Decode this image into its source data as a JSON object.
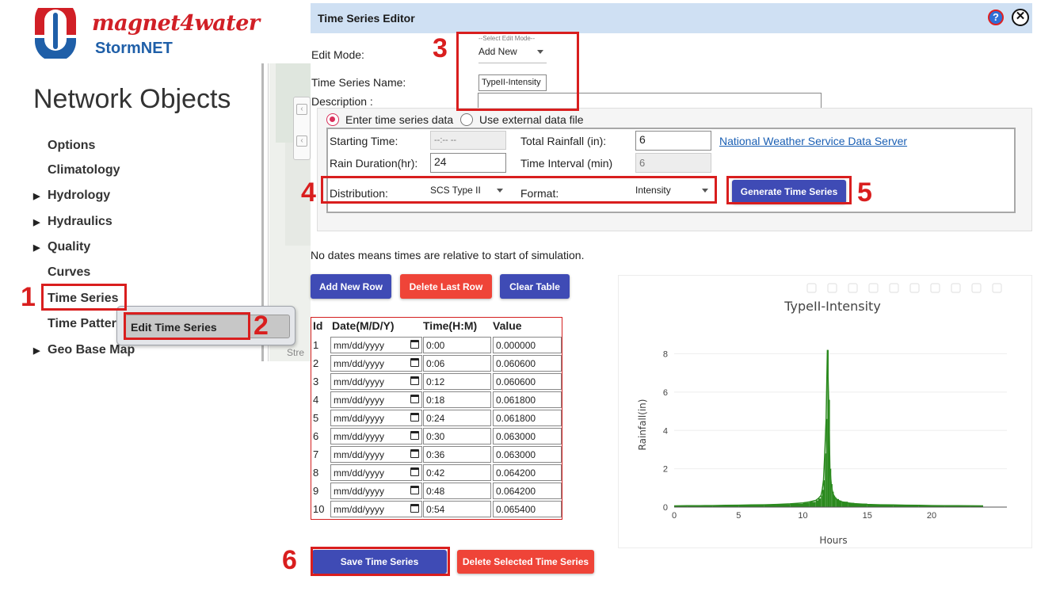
{
  "brand": {
    "name": "magnet4water",
    "product": "StormNET"
  },
  "nav": {
    "title": "Network Objects",
    "items": [
      {
        "label": "Options",
        "expandable": false
      },
      {
        "label": "Climatology",
        "expandable": false
      },
      {
        "label": "Hydrology",
        "expandable": true
      },
      {
        "label": "Hydraulics",
        "expandable": true
      },
      {
        "label": "Quality",
        "expandable": true
      },
      {
        "label": "Curves",
        "expandable": false
      },
      {
        "label": "Time Series",
        "expandable": false
      },
      {
        "label": "Time Patter",
        "expandable": false
      },
      {
        "label": "Geo Base Map",
        "expandable": true
      }
    ],
    "context_menu_item": "Edit Time Series"
  },
  "map": {
    "partial_label": "Stre"
  },
  "editor": {
    "title": "Time Series Editor",
    "help_icon": "help-icon",
    "close_icon": "close-icon",
    "edit_mode": {
      "label": "Edit Mode:",
      "hint": "--Select Edit Mode--",
      "value": "Add New"
    },
    "name": {
      "label": "Time Series Name:",
      "value": "TypeII-Intensity"
    },
    "description": {
      "label": "Description :",
      "value": ""
    },
    "source_options": [
      {
        "label": "Enter time series data",
        "selected": true
      },
      {
        "label": "Use external data file",
        "selected": false
      }
    ],
    "starting_time": {
      "label": "Starting Time:",
      "value": "--:-- --"
    },
    "total_rainfall": {
      "label": "Total Rainfall (in):",
      "value": "6"
    },
    "nws_link": "National Weather Service Data Server",
    "rain_duration": {
      "label": "Rain Duration(hr):",
      "value": "24"
    },
    "time_interval": {
      "label": "Time Interval (min)",
      "value": "6"
    },
    "distribution": {
      "label": "Distribution:",
      "value": "SCS Type II"
    },
    "format": {
      "label": "Format:",
      "value": "Intensity"
    },
    "generate_button": "Generate Time Series",
    "note": "No dates means times are relative to start of simulation.",
    "add_row_button": "Add New Row",
    "delete_row_button": "Delete Last Row",
    "clear_button": "Clear Table",
    "table": {
      "columns": [
        "Id",
        "Date(M/D/Y)",
        "Time(H:M)",
        "Value"
      ],
      "date_placeholder": "mm/dd/yyyy",
      "rows": [
        {
          "id": "1",
          "time": "0:00",
          "value": "0.000000"
        },
        {
          "id": "2",
          "time": "0:06",
          "value": "0.060600"
        },
        {
          "id": "3",
          "time": "0:12",
          "value": "0.060600"
        },
        {
          "id": "4",
          "time": "0:18",
          "value": "0.061800"
        },
        {
          "id": "5",
          "time": "0:24",
          "value": "0.061800"
        },
        {
          "id": "6",
          "time": "0:30",
          "value": "0.063000"
        },
        {
          "id": "7",
          "time": "0:36",
          "value": "0.063000"
        },
        {
          "id": "8",
          "time": "0:42",
          "value": "0.064200"
        },
        {
          "id": "9",
          "time": "0:48",
          "value": "0.064200"
        },
        {
          "id": "10",
          "time": "0:54",
          "value": "0.065400"
        }
      ]
    },
    "save_button": "Save Time Series",
    "delete_series_button": "Delete Selected Time Series"
  },
  "callouts": [
    "1",
    "2",
    "3",
    "4",
    "5",
    "6"
  ],
  "colors": {
    "highlight": "#d91e1e",
    "primary_button": "#3f4bb5",
    "danger_button": "#ef4438",
    "series": "#2b8a1e",
    "link": "#1a5fb4"
  },
  "chart_data": {
    "type": "bar",
    "title": "TypeII-Intensity",
    "xlabel": "Hours",
    "ylabel": "Rainfall(in)",
    "xlim": [
      0,
      24
    ],
    "ylim": [
      0,
      8.6
    ],
    "xticks": [
      0,
      5,
      10,
      15,
      20
    ],
    "yticks": [
      0,
      2,
      4,
      6,
      8
    ],
    "series": [
      {
        "color": "#2b8a1e",
        "x": [
          0,
          1,
          2,
          3,
          4,
          5,
          6,
          7,
          8,
          9,
          10,
          10.5,
          11,
          11.2,
          11.4,
          11.5,
          11.6,
          11.7,
          11.8,
          11.9,
          12.0,
          12.1,
          12.2,
          12.3,
          12.4,
          12.5,
          12.6,
          12.8,
          13,
          13.5,
          14,
          15,
          16,
          17,
          18,
          19,
          20,
          21,
          22,
          23,
          24
        ],
        "y": [
          0.06,
          0.07,
          0.075,
          0.08,
          0.09,
          0.1,
          0.11,
          0.12,
          0.14,
          0.17,
          0.22,
          0.27,
          0.35,
          0.45,
          0.6,
          0.9,
          1.4,
          2.8,
          4.6,
          8.2,
          5.6,
          2.0,
          1.2,
          0.8,
          0.6,
          0.5,
          0.42,
          0.34,
          0.28,
          0.22,
          0.18,
          0.14,
          0.12,
          0.11,
          0.1,
          0.09,
          0.08,
          0.075,
          0.07,
          0.065,
          0.06
        ]
      }
    ]
  }
}
